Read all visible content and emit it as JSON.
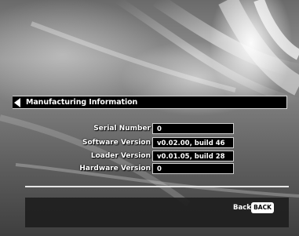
{
  "header": {
    "title": "Manufacturing Information",
    "back_arrow_icon": "left-arrow-icon"
  },
  "info_rows": [
    {
      "label": "Serial Number",
      "value": "0"
    },
    {
      "label": "Software Version",
      "value": "v0.02.00, build 46"
    },
    {
      "label": "Loader Version",
      "value": "v0.01.05, build 28"
    },
    {
      "label": "Hardware Version",
      "value": "0"
    }
  ],
  "footer": {
    "back_label": "Back",
    "back_key": "BACK"
  }
}
